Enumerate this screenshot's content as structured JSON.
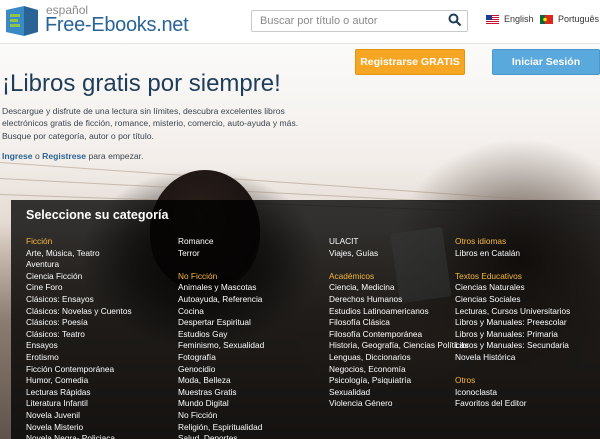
{
  "header": {
    "logo_sub": "español",
    "logo_main": "Free-Ebooks.net",
    "search_placeholder": "Buscar por título o autor",
    "lang_en": "English",
    "lang_pt": "Português"
  },
  "hero": {
    "title": "¡Libros gratis por siempre!",
    "description": "Descargue y disfrute de una lectura sin límites, descubra excelentes libros electrónicos gratis de ficción, romance, misterio, comercio, auto-ayuda y más. Busque por categoría, autor o por título.",
    "login_link": "Ingrese",
    "login_mid": " o ",
    "register_link": "Registrese",
    "login_tail": " para empezar.",
    "register_button": "Registrarse GRATIS",
    "login_button": "Iniciar Sesión"
  },
  "categories": {
    "heading": "Seleccione su categoría",
    "col1": [
      {
        "t": "Ficción",
        "h": true
      },
      {
        "t": "Arte, Música, Teatro"
      },
      {
        "t": "Aventura"
      },
      {
        "t": "Ciencia Ficción"
      },
      {
        "t": "Cine Foro"
      },
      {
        "t": "Clásicos: Ensayos"
      },
      {
        "t": "Clásicos: Novelas y Cuentos"
      },
      {
        "t": "Clásicos: Poesía"
      },
      {
        "t": "Clásicos: Teatro"
      },
      {
        "t": "Ensayos"
      },
      {
        "t": "Erotismo"
      },
      {
        "t": "Ficción Contemporánea"
      },
      {
        "t": "Humor, Comedia"
      },
      {
        "t": "Lecturas Rápidas"
      },
      {
        "t": "Literatura Infantil"
      },
      {
        "t": "Novela Juvenil"
      },
      {
        "t": "Novela Misterio"
      },
      {
        "t": "Novela Negra- Policiaca"
      }
    ],
    "col2": [
      {
        "t": "Romance"
      },
      {
        "t": "Terror"
      },
      {
        "t": "",
        "g": true
      },
      {
        "t": "No Ficción",
        "h": true
      },
      {
        "t": "Animales y Mascotas"
      },
      {
        "t": "Autoayuda, Referencia"
      },
      {
        "t": "Cocina"
      },
      {
        "t": "Despertar Espiritual"
      },
      {
        "t": "Estudios Gay"
      },
      {
        "t": "Feminismo, Sexualidad"
      },
      {
        "t": "Fotografía"
      },
      {
        "t": "Genocidio"
      },
      {
        "t": "Moda, Belleza"
      },
      {
        "t": "Muestras Gratis"
      },
      {
        "t": "Mundo Digital"
      },
      {
        "t": "No Ficción"
      },
      {
        "t": "Religión, Espiritualidad"
      },
      {
        "t": "Salud, Deportes"
      }
    ],
    "col3": [
      {
        "t": "ULACIT"
      },
      {
        "t": "Viajes, Guías"
      },
      {
        "t": "",
        "g": true
      },
      {
        "t": "Académicos",
        "h": true
      },
      {
        "t": "Ciencia, Medicina"
      },
      {
        "t": "Derechos Humanos"
      },
      {
        "t": "Estudios Latinoamericanos"
      },
      {
        "t": "Filosofía Clásica"
      },
      {
        "t": "Filosofía Contemporánea"
      },
      {
        "t": "Historia, Geografía, Ciencias Políticas"
      },
      {
        "t": "Lenguas, Diccionarios"
      },
      {
        "t": "Negocios, Economía"
      },
      {
        "t": "Psicología, Psiquiatría"
      },
      {
        "t": "Sexualidad"
      },
      {
        "t": "Violencia Género"
      }
    ],
    "col4": [
      {
        "t": "Otros idiomas",
        "h": true
      },
      {
        "t": "Libros en Catalán"
      },
      {
        "t": "",
        "g": true
      },
      {
        "t": "Textos Educativos",
        "h": true
      },
      {
        "t": "Ciencias Naturales"
      },
      {
        "t": "Ciencias Sociales"
      },
      {
        "t": "Lecturas, Cursos Universitarios"
      },
      {
        "t": "Libros y Manuales: Preescolar"
      },
      {
        "t": "Libros y Manuales: Primaria"
      },
      {
        "t": "Libros y Manuales: Secundaria"
      },
      {
        "t": "Novela Histórica"
      },
      {
        "t": "",
        "g": true
      },
      {
        "t": "Otros",
        "h": true
      },
      {
        "t": "Iconoclasta"
      },
      {
        "t": "Favoritos del Editor"
      }
    ]
  }
}
